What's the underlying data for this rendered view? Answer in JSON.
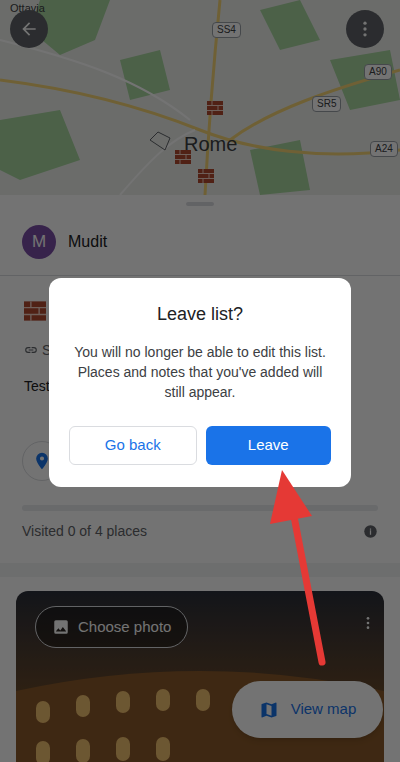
{
  "map": {
    "labels": [
      {
        "text": "Ottavia",
        "kind": "place"
      },
      {
        "text": "SS4",
        "kind": "road"
      },
      {
        "text": "A90",
        "kind": "road"
      },
      {
        "text": "SR5",
        "kind": "road"
      },
      {
        "text": "A24",
        "kind": "road"
      },
      {
        "text": "Rome",
        "kind": "city"
      }
    ]
  },
  "owner": {
    "initial": "M",
    "name": "Mudit"
  },
  "list": {
    "link": "S",
    "description": "Test"
  },
  "progress": {
    "label": "Visited 0 of 4 places",
    "level": 0
  },
  "photo": {
    "button": "Choose photo"
  },
  "view_map": {
    "label": "View map"
  },
  "dialog": {
    "title": "Leave list?",
    "message": "You will no longer be able to edit this list. Places and notes that you've added will still appear.",
    "buttons": [
      {
        "label": "Go back",
        "primary": false
      },
      {
        "label": "Leave",
        "primary": true
      }
    ]
  }
}
